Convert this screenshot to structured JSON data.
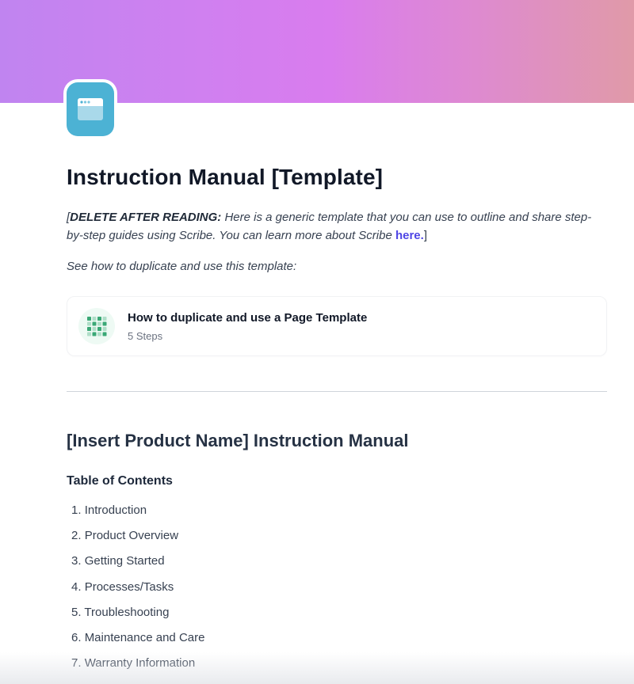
{
  "cover": {
    "gradient_colors": [
      "#c084f0",
      "#d97cee",
      "#e09aa8"
    ]
  },
  "page_icon": {
    "icon": "browser-window-icon",
    "background": "#4cb2d4"
  },
  "title": "Instruction Manual [Template]",
  "intro": {
    "open_bracket": "[",
    "bold_label": "DELETE AFTER READING:",
    "text": " Here is a generic template that you can use to outline and share step-by-step guides using Scribe. You can learn more about Scribe ",
    "link_label": "here.",
    "close_bracket": "]",
    "link_color": "#4f46e5"
  },
  "see_how": "See how to duplicate and use this template:",
  "scribe_card": {
    "icon": "scribe-grid-icon",
    "title": "How to duplicate and use a Page Template",
    "subtitle": "5 Steps",
    "accent": "#3aa876"
  },
  "section": {
    "heading": "[Insert Product Name] Instruction Manual",
    "toc_heading": "Table of Contents",
    "toc": [
      {
        "number": "1.",
        "label": "Introduction"
      },
      {
        "number": "2.",
        "label": "Product Overview"
      },
      {
        "number": "3.",
        "label": "Getting Started"
      },
      {
        "number": "4.",
        "label": "Processes/Tasks"
      },
      {
        "number": "5.",
        "label": "Troubleshooting"
      },
      {
        "number": "6.",
        "label": "Maintenance and Care"
      },
      {
        "number": "7.",
        "label": "Warranty Information"
      }
    ]
  }
}
